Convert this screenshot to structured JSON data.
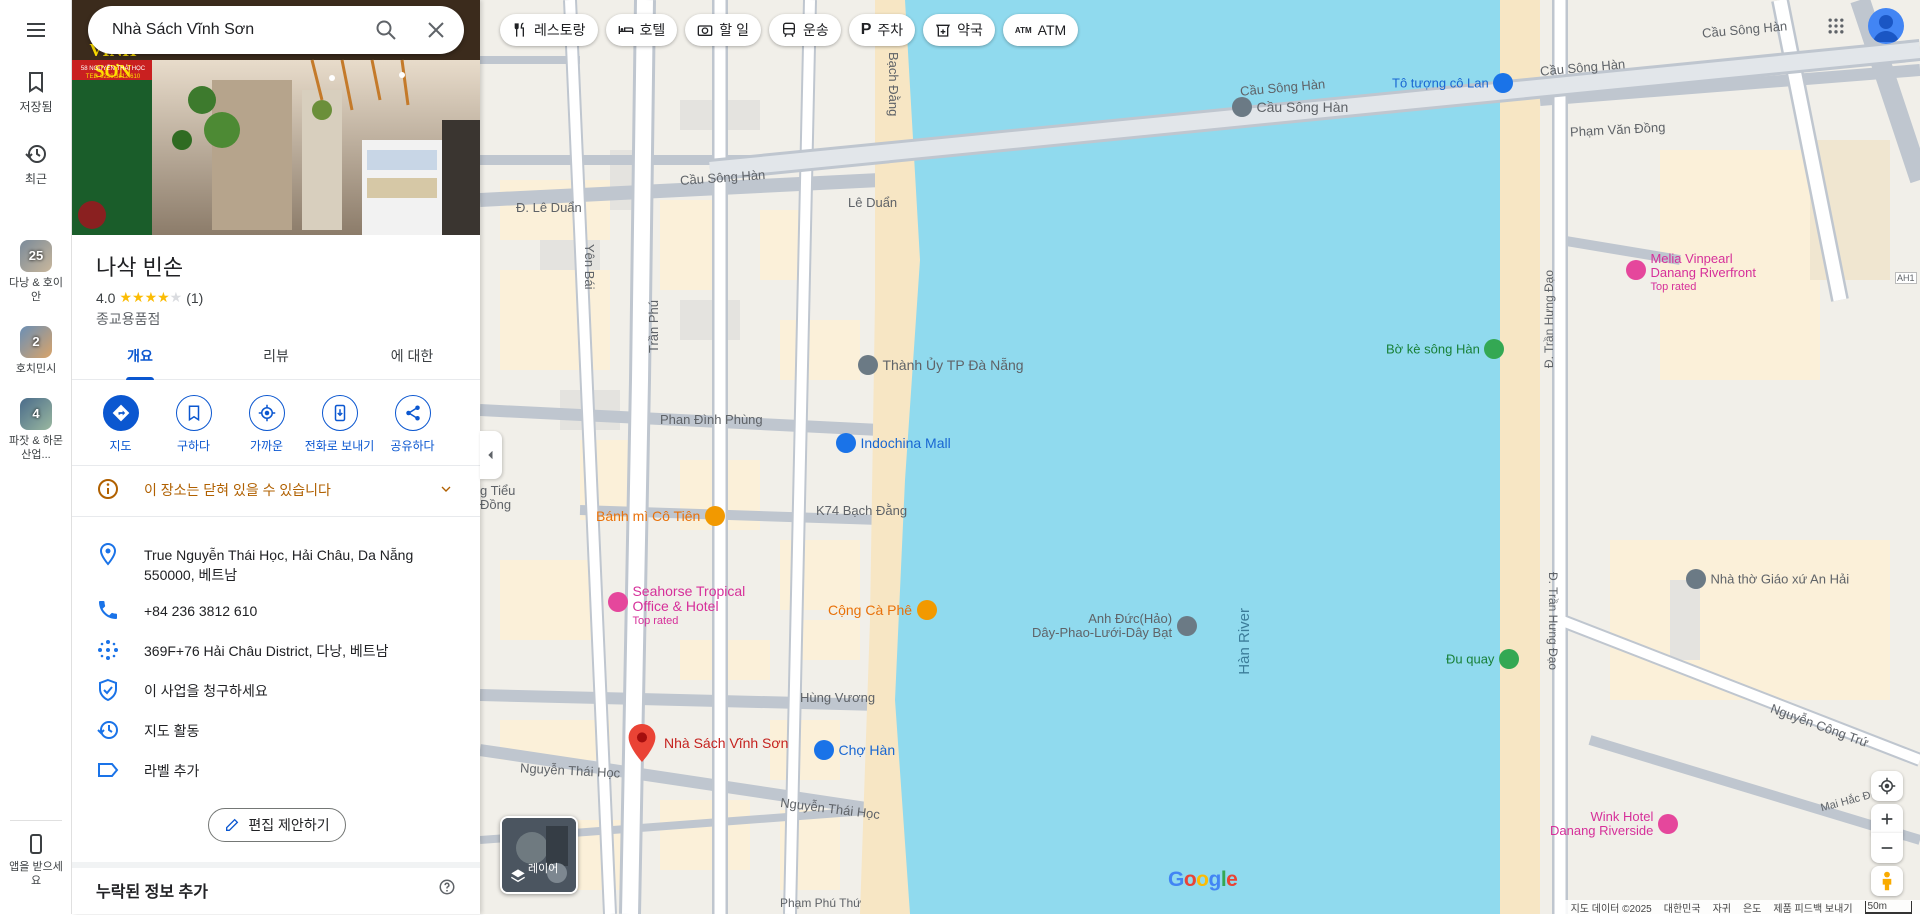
{
  "rail": {
    "saved_label": "저장됨",
    "recent_label": "최근",
    "recents": [
      {
        "label": "다낭 & 호이안",
        "count": "25"
      },
      {
        "label": "호치민시",
        "count": "2"
      },
      {
        "label": "파잣 & 하몬 산업...",
        "count": "4"
      }
    ],
    "get_app_label": "앱을 받으세요"
  },
  "search": {
    "value": "Nhà Sách Vĩnh Sơn"
  },
  "place": {
    "name": "나삭 빈손",
    "rating": "4.0",
    "rating_value": 4,
    "review_count": "(1)",
    "category": "종교용품점",
    "photo_sign_name": "VĨNH SƠN",
    "photo_sign_address": "58 NGUYỄN THÁI HỌC",
    "photo_sign_phone": "TEL: 0236.3812.610"
  },
  "tabs": [
    {
      "label": "개요",
      "active": true
    },
    {
      "label": "리뷰",
      "active": false
    },
    {
      "label": "에 대한",
      "active": false
    }
  ],
  "actions": [
    {
      "label": "지도",
      "icon": "directions-icon"
    },
    {
      "label": "구하다",
      "icon": "bookmark-icon"
    },
    {
      "label": "가까운",
      "icon": "nearby-icon"
    },
    {
      "label": "전화로 보내기",
      "icon": "send-to-phone-icon"
    },
    {
      "label": "공유하다",
      "icon": "share-icon"
    }
  ],
  "notice": "이 장소는 닫혀 있을 수 있습니다",
  "info": {
    "address": "True Nguyễn Thái Học, Hải Châu, Da Nẵng 550000, 베트남",
    "phone": "+84 236 3812 610",
    "plus_code": "369F+76 Hải Châu District, 다낭, 베트남",
    "claim": "이 사업을 청구하세요",
    "activity": "지도 활동",
    "label": "라벨 추가"
  },
  "edit_suggest": "편집 제안하기",
  "missing_info": "누락된 정보 추가",
  "chips": [
    {
      "label": "레스토랑",
      "icon": "restaurant-icon"
    },
    {
      "label": "호텔",
      "icon": "hotel-icon"
    },
    {
      "label": "할 일",
      "icon": "camera-icon"
    },
    {
      "label": "운송",
      "icon": "transit-icon"
    },
    {
      "label": "주차",
      "icon": "parking-icon"
    },
    {
      "label": "약국",
      "icon": "pharmacy-icon"
    },
    {
      "label": "ATM",
      "icon": "atm-icon"
    }
  ],
  "map": {
    "streets": {
      "cau_song_han": "Cầu Sông Hàn",
      "le_duan_1": "Đ. Lê Duẩn",
      "le_duan_2": "Lê Duẩn",
      "yen_bai": "Yên Bái",
      "tran_phu": "Trần Phú",
      "bach_dang": "Bạch Đằng",
      "phan_dinh_phung": "Phan Đình Phùng",
      "k74": "K74 Bạch Đằng",
      "hung_vuong": "Hùng Vương",
      "nguyen_thai_hoc": "Nguyễn Thái Học",
      "pham_phu_thu": "Phạm Phú Thứ",
      "pham_van_dong": "Phạm Văn Đồng",
      "tran_hung_dao": "Đ. Trần Hưng Đạo",
      "nguyen_cong_tru": "Nguyễn Công Trứ",
      "mai_hac_de": "Mai Hắc Đế",
      "han_river": "Hàn River"
    },
    "pois": {
      "target": "Nhà Sách Vĩnh Sơn",
      "thanh_uy": "Thành Ủy TP Đà Nẵng",
      "indochina": "Indochina Mall",
      "banh_mi": "Bánh mì Cô Tiên",
      "seahorse_1": "Seahorse Tropical",
      "seahorse_2": "Office & Hotel",
      "top_rated": "Top rated",
      "cong_ca_phe": "Cộng Cà Phê",
      "cho_han": "Chợ Hàn",
      "anh_duc_1": "Anh Đức(Hảo)",
      "anh_duc_2": "Dây-Phao-Lưới-Dây Bạt",
      "to_tuong": "Tô tượng cô Lan",
      "cau_song_han_poi": "Cầu Sông Hàn",
      "melia_1": "Melia Vinpearl",
      "melia_2": "Danang Riverfront",
      "bo_ke": "Bờ kè sông Hàn",
      "nha_tho": "Nhà thờ Giáo xứ An Hải",
      "du_quay": "Đu quay",
      "wink_1": "Wink Hotel",
      "wink_2": "Danang Riverside",
      "partial_1": "g Tiểu",
      "partial_2": "Đồng",
      "marker_ah": "AH1"
    },
    "layers_label": "레이어",
    "attribution": [
      "지도 데이터 ©2025",
      "대한민국",
      "자귀",
      "은도",
      "제품 피드백 보내기",
      "50m"
    ],
    "google_logo": "Google"
  }
}
